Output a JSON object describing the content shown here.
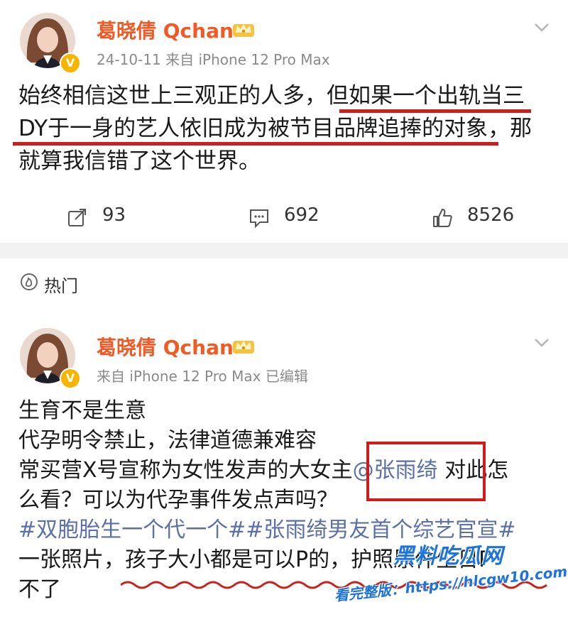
{
  "post1": {
    "username": "葛晓倩 Qchan",
    "meta": "24-10-11  来自 iPhone 12 Pro Max",
    "lines": [
      "始终相信这世上三观正的人多，但如果一个出轨当三",
      "DY于一身的艺人依旧成为被节目品牌追捧的对象，那",
      "就算我信错了这个世界。"
    ],
    "stats": {
      "repost": "93",
      "comment": "692",
      "like": "8526"
    }
  },
  "hot": {
    "label": "热门"
  },
  "post2": {
    "username": "葛晓倩 Qchan",
    "meta": "来自 iPhone 12 Pro Max  已编辑",
    "lines": {
      "l1": "生育不是生意",
      "l2": "代孕明令禁止，法律道德兼难容",
      "l3a": "常买营X号宣称为女性发声的大女主",
      "l3mention": "@张雨绮",
      "l3b": " 对此怎",
      "l4": "么看？可以为代孕事件发点声吗？",
      "l5": "#双胞胎生一个代一个##张雨绮男友首个综艺官宣#",
      "l6": "一张照片，孩子大小都是可以P的，护照原件生日P",
      "l7": "不了"
    }
  },
  "watermark": {
    "logo": "黑料吃瓜网",
    "url": "看完整版：https://hlcgw10.com"
  },
  "colors": {
    "accent": "#f15a24",
    "link": "#5b6fa8",
    "highlight": "#c8201c"
  }
}
